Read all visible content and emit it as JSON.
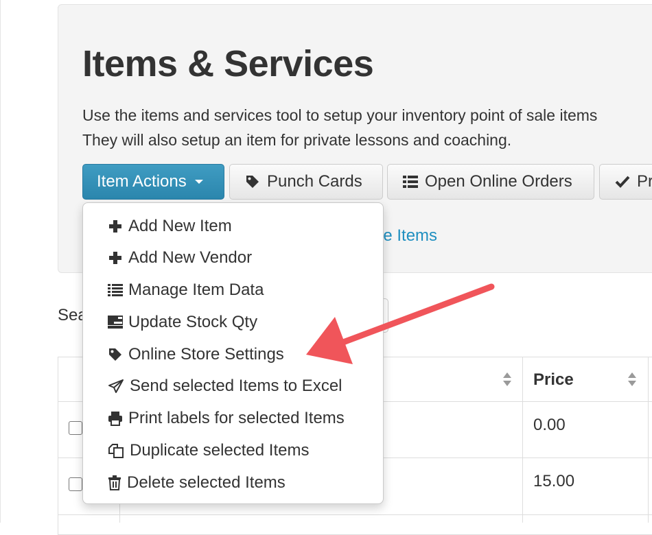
{
  "page": {
    "title": "Items & Services",
    "intro_line1": "Use the items and services tool to setup your inventory point of sale items",
    "intro_line2": "They will also setup an item for private lessons and coaching."
  },
  "toolbar": {
    "item_actions_label": "Item Actions",
    "punch_cards_label": "Punch Cards",
    "open_online_orders_label": "Open Online Orders",
    "partial_button_label": "Pr"
  },
  "partial_link_text": "ne Items",
  "search": {
    "label": "Sea"
  },
  "table": {
    "headers": {
      "price": "Price"
    },
    "rows": [
      {
        "price": "0.00"
      },
      {
        "price": "15.00"
      }
    ]
  },
  "dropdown": {
    "items": [
      {
        "label": "Add New Item",
        "icon": "plus-icon"
      },
      {
        "label": "Add New Vendor",
        "icon": "plus-icon"
      },
      {
        "label": "Manage Item Data",
        "icon": "list-icon"
      },
      {
        "label": "Update Stock Qty",
        "icon": "tasks-icon"
      },
      {
        "label": "Online Store Settings",
        "icon": "tag-icon"
      },
      {
        "label": "Send selected Items to Excel",
        "icon": "send-icon"
      },
      {
        "label": "Print labels for selected Items",
        "icon": "print-icon"
      },
      {
        "label": "Duplicate selected Items",
        "icon": "duplicate-icon"
      },
      {
        "label": "Delete selected Items",
        "icon": "trash-icon"
      }
    ]
  },
  "colors": {
    "primary_button": "#2f8db6",
    "link": "#1f8fc0",
    "annotation_arrow": "#f0555a",
    "jumbotron_bg": "#f4f4f4"
  }
}
